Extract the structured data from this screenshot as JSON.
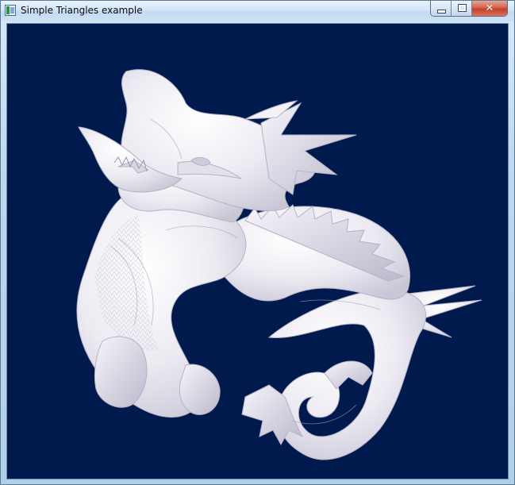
{
  "window": {
    "title": "Simple Triangles example",
    "icon": "app-window-icon",
    "buttons": {
      "minimize": "minimize-icon",
      "maximize": "maximize-icon",
      "close": "close-icon"
    }
  },
  "viewport": {
    "background": "#001a4d",
    "model_color": "#eceaf2",
    "subject": "dragon-model"
  }
}
